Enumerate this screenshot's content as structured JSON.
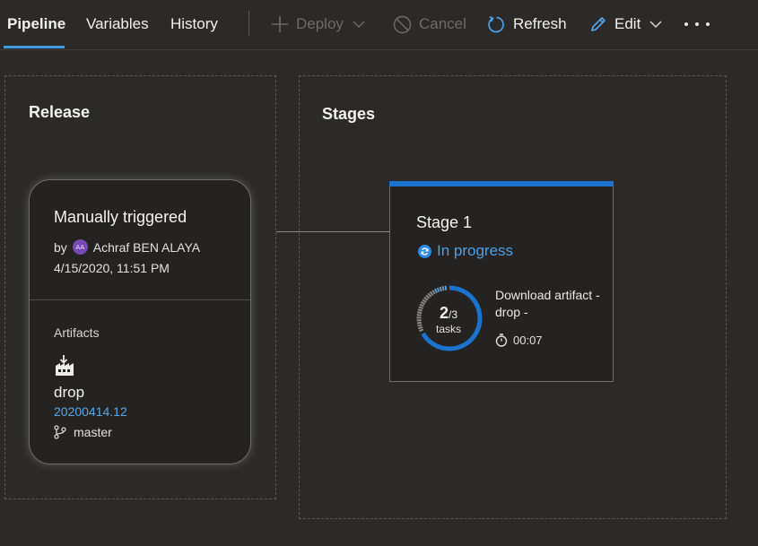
{
  "tabs": [
    {
      "label": "Pipeline",
      "active": true
    },
    {
      "label": "Variables"
    },
    {
      "label": "History"
    }
  ],
  "commands": {
    "deploy": "Deploy",
    "cancel": "Cancel",
    "refresh": "Refresh",
    "edit": "Edit"
  },
  "release_panel": {
    "title": "Release",
    "card": {
      "title": "Manually triggered",
      "by_prefix": "by",
      "avatar_initials": "AA",
      "user": "Achraf BEN ALAYA",
      "date": "4/15/2020, 11:51 PM",
      "artifacts_label": "Artifacts",
      "artifact_name": "drop",
      "artifact_version": "20200414.12",
      "branch": "master"
    }
  },
  "stages_panel": {
    "title": "Stages",
    "stage": {
      "name": "Stage 1",
      "status": "In progress",
      "tasks_done": "2",
      "tasks_total": "/3",
      "tasks_completed": 2,
      "tasks_count": 3,
      "tasks_label": "tasks",
      "current_task": "Download artifact - drop -",
      "elapsed": "00:07"
    }
  },
  "colors": {
    "accent": "#3f9ae0",
    "stage_bar": "#1a73cf",
    "status_in_progress": "#4ba0e8",
    "avatar_bg": "#7649b4"
  },
  "icons": [
    "plus-icon",
    "chevron-down-icon",
    "cancel-icon",
    "refresh-icon",
    "pencil-icon",
    "more-icon",
    "build-artifact-icon",
    "branch-icon",
    "in-progress-icon",
    "timer-icon"
  ]
}
